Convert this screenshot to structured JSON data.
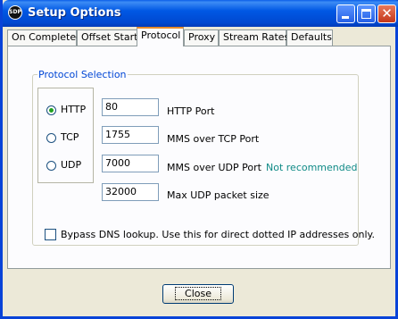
{
  "window": {
    "title": "Setup Options",
    "icon_text": "SDP"
  },
  "tabs": [
    "On Completed",
    "Offset Start",
    "Protocol",
    "Proxy",
    "Stream Rates",
    "Defaults"
  ],
  "active_tab": "Protocol",
  "group": {
    "label": "Protocol Selection"
  },
  "radios": [
    {
      "label": "HTTP",
      "checked": true
    },
    {
      "label": "TCP",
      "checked": false
    },
    {
      "label": "UDP",
      "checked": false
    }
  ],
  "fields": [
    {
      "value": "80",
      "label": "HTTP Port"
    },
    {
      "value": "1755",
      "label": "MMS over TCP Port"
    },
    {
      "value": "7000",
      "label": "MMS over UDP Port"
    },
    {
      "value": "32000",
      "label": "Max UDP packet size"
    }
  ],
  "udp_note": "Not recommended",
  "bypass_dns": {
    "label": "Bypass DNS lookup. Use this for direct dotted IP addresses only.",
    "checked": false
  },
  "close_button": "Close"
}
